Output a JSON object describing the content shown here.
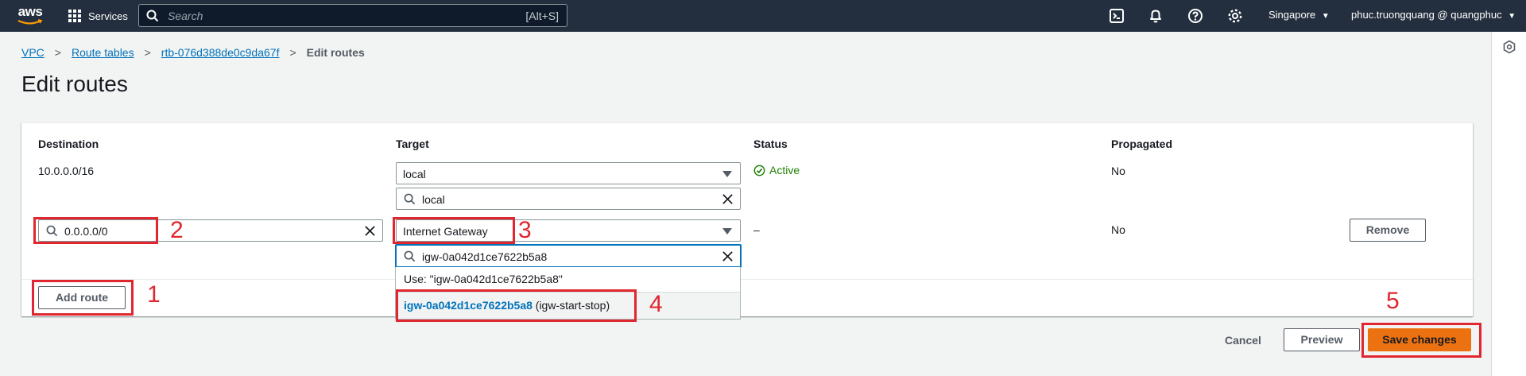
{
  "nav": {
    "logo": "aws",
    "services_label": "Services",
    "search_placeholder": "Search",
    "search_shortcut": "[Alt+S]",
    "region": "Singapore",
    "user": "phuc.truongquang @ quangphuc",
    "icons": [
      "cloudshell-icon",
      "bell-icon",
      "help-icon",
      "gear-icon"
    ]
  },
  "breadcrumb": {
    "items": [
      "VPC",
      "Route tables",
      "rtb-076d388de0c9da67f"
    ],
    "current": "Edit routes"
  },
  "page_title": "Edit routes",
  "table": {
    "headers": [
      "Destination",
      "Target",
      "Status",
      "Propagated"
    ],
    "rows": [
      {
        "destination": "10.0.0.0/16",
        "target_selected": "local",
        "target_filter": "local",
        "status": "Active",
        "propagated": "No"
      },
      {
        "destination_filter": "0.0.0.0/0",
        "target_selected": "Internet Gateway",
        "target_filter": "igw-0a042d1ce7622b5a8",
        "status": "–",
        "propagated": "No",
        "remove_label": "Remove"
      }
    ],
    "dropdown": {
      "use_option": "Use: \"igw-0a042d1ce7622b5a8\"",
      "option_id": "igw-0a042d1ce7622b5a8",
      "option_name": "(igw-start-stop)"
    },
    "add_route_label": "Add route"
  },
  "actions": {
    "cancel": "Cancel",
    "preview": "Preview",
    "save": "Save changes"
  },
  "annotations": [
    "1",
    "2",
    "3",
    "4",
    "5"
  ],
  "colors": {
    "nav_bg": "#232f3e",
    "link": "#0073bb",
    "primary": "#ec7211",
    "active_green": "#1d8102",
    "annotation_red": "#e0262f"
  }
}
